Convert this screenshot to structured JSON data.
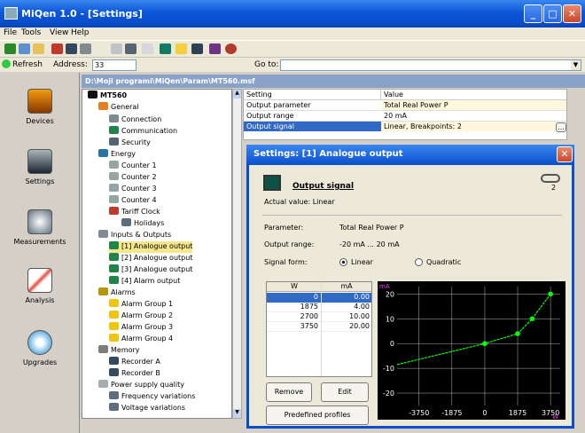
{
  "window": {
    "title": "MiQen 1.0 - [Settings]"
  },
  "menu": [
    "File",
    "Tools",
    "View",
    "Help"
  ],
  "address": {
    "refresh_label": "Refresh",
    "address_label": "Address:",
    "address_value": "33",
    "goto_label": "Go to:"
  },
  "sidebar": [
    {
      "label": "Devices",
      "icon": "house-icon"
    },
    {
      "label": "Settings",
      "icon": "settings-icon"
    },
    {
      "label": "Measurements",
      "icon": "gauge-icon"
    },
    {
      "label": "Analysis",
      "icon": "chart-icon"
    },
    {
      "label": "Upgrades",
      "icon": "cd-icon"
    }
  ],
  "path": "D:\\Moji programi\\MiQen\\Param\\MT560.msf",
  "tree": [
    {
      "label": "MT560"
    },
    {
      "label": "General"
    },
    {
      "label": "Connection"
    },
    {
      "label": "Communication"
    },
    {
      "label": "Security"
    },
    {
      "label": "Energy"
    },
    {
      "label": "Counter 1"
    },
    {
      "label": "Counter 2"
    },
    {
      "label": "Counter 3"
    },
    {
      "label": "Counter 4"
    },
    {
      "label": "Tariff Clock"
    },
    {
      "label": "Holidays"
    },
    {
      "label": "Inputs & Outputs"
    },
    {
      "label": "[1] Analogue output"
    },
    {
      "label": "[2] Analogue output"
    },
    {
      "label": "[3] Analogue output"
    },
    {
      "label": "[4] Alarm output"
    },
    {
      "label": "Alarms"
    },
    {
      "label": "Alarm Group 1"
    },
    {
      "label": "Alarm Group 2"
    },
    {
      "label": "Alarm Group 3"
    },
    {
      "label": "Alarm Group 4"
    },
    {
      "label": "Memory"
    },
    {
      "label": "Recorder A"
    },
    {
      "label": "Recorder B"
    },
    {
      "label": "Power supply quality"
    },
    {
      "label": "Frequency variations"
    },
    {
      "label": "Voltage variations"
    }
  ],
  "properties": {
    "headers": [
      "Setting",
      "Value"
    ],
    "rows": [
      {
        "setting": "Output parameter",
        "value": "Total Real Power P"
      },
      {
        "setting": "Output range",
        "value": "20 mA"
      },
      {
        "setting": "Output signal",
        "value": "Linear, Breakpoints: 2",
        "button": "..."
      }
    ]
  },
  "dialog": {
    "title": "Settings: [1] Analogue output",
    "heading": "Output signal",
    "level_number": "2",
    "actual_value": "Actual value:  Linear",
    "parameter_label": "Parameter:",
    "parameter_value": "Total Real Power P",
    "range_label": "Output range:",
    "range_value": "-20 mA ... 20 mA",
    "signal_label": "Signal form:",
    "option_linear": "Linear",
    "option_quadratic": "Quadratic",
    "table_headers": [
      "W",
      "mA"
    ],
    "table_rows": [
      {
        "w": "0",
        "ma": "0.00"
      },
      {
        "w": "1875",
        "ma": "4.00"
      },
      {
        "w": "2700",
        "ma": "10.00"
      },
      {
        "w": "3750",
        "ma": "20.00"
      }
    ],
    "remove_label": "Remove",
    "edit_label": "Edit",
    "predefined_label": "Predefined profiles"
  },
  "chart_data": {
    "type": "line",
    "ylabel": "mA",
    "xlabel": "W",
    "x_ticks": [
      "-3750",
      "-1875",
      "0",
      "1875",
      "3750"
    ],
    "y_ticks": [
      "20",
      "10",
      "0",
      "-10",
      "-20"
    ],
    "xlim": [
      -5000,
      4300
    ],
    "ylim": [
      -25,
      23
    ],
    "series": [
      {
        "x": [
          -5000,
          0,
          1875,
          2700,
          3750
        ],
        "y": [
          -8.5,
          0,
          4,
          10,
          20
        ]
      }
    ],
    "points": [
      [
        0,
        0
      ],
      [
        1875,
        4
      ],
      [
        2700,
        10
      ],
      [
        3750,
        20
      ]
    ],
    "colors": {
      "line": "#00ff00",
      "grid": "#ffffff",
      "text": "#ffffff",
      "label": "#ff33ff"
    }
  }
}
